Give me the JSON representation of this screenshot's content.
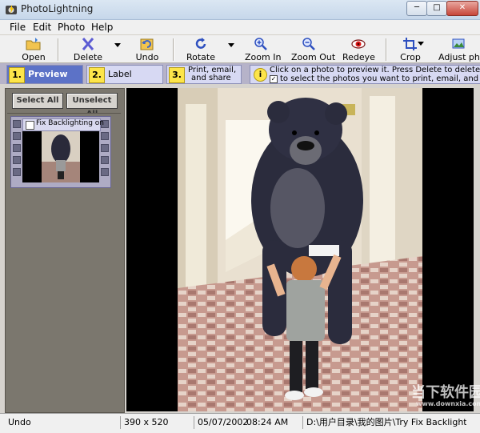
{
  "window": {
    "title": "PhotoLightning"
  },
  "menu": [
    "File",
    "Edit",
    "Photo",
    "Help"
  ],
  "toolbar": {
    "open": "Open",
    "delete": "Delete",
    "undo": "Undo",
    "rotate": "Rotate",
    "zoom_in": "Zoom In",
    "zoom_out": "Zoom Out",
    "redeye": "Redeye",
    "crop": "Crop",
    "adjust": "Adjust pho"
  },
  "steps": [
    {
      "num": "1.",
      "label": "Preview"
    },
    {
      "num": "2.",
      "label": "Label"
    },
    {
      "num": "3.",
      "label_lines": [
        "Print, email,",
        "and share"
      ]
    }
  ],
  "info": {
    "icon": "i",
    "line1": "Click on a photo to preview it.  Press Delete to delete a photo.",
    "line2": "to select the photos you want to print, email, and share."
  },
  "left_panel": {
    "select_all": "Select All",
    "unselect_all": "Unselect All",
    "thumb_caption": "Fix Backlighting on"
  },
  "status": {
    "action": "Undo",
    "dimensions": "390 x 520",
    "date": "05/07/2002",
    "time": "08:24 AM",
    "path": "D:\\用户目录\\我的图片\\Try Fix Backlightin"
  },
  "watermark": {
    "line1": "当下软件园",
    "line2": "www.downxia.com"
  },
  "colors": {
    "accent": "#5c72c7",
    "step_bg": "#d7d9f3",
    "badge": "#fde54a"
  }
}
